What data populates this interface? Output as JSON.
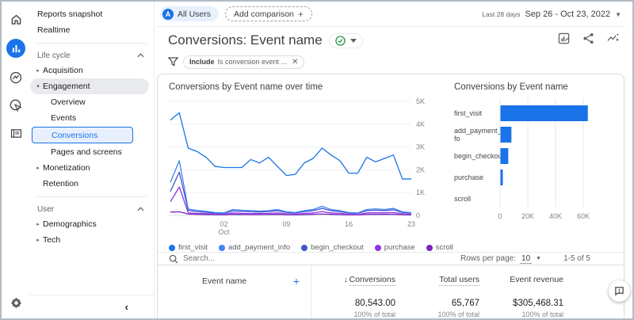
{
  "theme": {
    "accent": "#1a73e8",
    "selected_bg": "#e8f0fe",
    "bar_color": "#1a73e8"
  },
  "rail": {
    "items": [
      "home",
      "reports",
      "explore",
      "advertising",
      "configure"
    ],
    "selected": "reports"
  },
  "sidebar": {
    "primary": [
      {
        "label": "Reports snapshot"
      },
      {
        "label": "Realtime"
      }
    ],
    "sections": [
      {
        "title": "Life cycle",
        "items": [
          {
            "label": "Acquisition"
          },
          {
            "label": "Engagement",
            "expanded": true,
            "children": [
              {
                "label": "Overview"
              },
              {
                "label": "Events"
              },
              {
                "label": "Conversions",
                "selected": true
              },
              {
                "label": "Pages and screens"
              }
            ]
          },
          {
            "label": "Monetization"
          },
          {
            "label": "Retention"
          }
        ]
      },
      {
        "title": "User",
        "items": [
          {
            "label": "Demographics"
          },
          {
            "label": "Tech"
          }
        ]
      }
    ]
  },
  "topbar": {
    "segment_badge": "A",
    "segment_label": "All Users",
    "add_comparison_label": "Add comparison",
    "add_comparison_plus": "+",
    "date_preset": "Last 28 days",
    "date_range": "Sep 26 - Oct 23, 2022"
  },
  "header": {
    "title": "Conversions: Event name"
  },
  "filter": {
    "keyword": "Include",
    "condition": "Is conversion event ...",
    "close": "✕"
  },
  "chart_data": [
    {
      "type": "line",
      "title": "Conversions by Event name over time",
      "ylim": [
        0,
        5000
      ],
      "y_ticks": [
        "0",
        "1K",
        "2K",
        "3K",
        "4K",
        "5K"
      ],
      "x_ticks": [
        {
          "index": 6,
          "label": "02",
          "sub": "Oct"
        },
        {
          "index": 13,
          "label": "09"
        },
        {
          "index": 20,
          "label": "16"
        },
        {
          "index": 27,
          "label": "23"
        }
      ],
      "x_range_days": 28,
      "grid": true,
      "legend_position": "bottom",
      "series": [
        {
          "name": "first_visit",
          "color": "#1a73e8",
          "values": [
            4180,
            4500,
            2950,
            2800,
            2550,
            2150,
            2100,
            2100,
            2100,
            2450,
            2300,
            2550,
            2150,
            1750,
            1800,
            2300,
            2500,
            2950,
            2650,
            2400,
            1850,
            1850,
            2550,
            2350,
            2500,
            2650,
            1600,
            1600
          ]
        },
        {
          "name": "add_payment_info",
          "color": "#4285f4",
          "values": [
            1450,
            2400,
            280,
            220,
            180,
            130,
            110,
            260,
            230,
            210,
            190,
            210,
            260,
            160,
            130,
            210,
            260,
            400,
            260,
            210,
            130,
            110,
            260,
            290,
            260,
            310,
            160,
            120
          ]
        },
        {
          "name": "begin_checkout",
          "color": "#4553c8",
          "values": [
            1050,
            1900,
            220,
            170,
            140,
            100,
            90,
            200,
            180,
            160,
            150,
            170,
            210,
            130,
            100,
            170,
            210,
            310,
            210,
            170,
            100,
            90,
            210,
            230,
            210,
            250,
            130,
            100
          ]
        },
        {
          "name": "purchase",
          "color": "#9334e6",
          "values": [
            600,
            1250,
            110,
            90,
            80,
            60,
            50,
            110,
            90,
            80,
            80,
            90,
            110,
            70,
            50,
            90,
            110,
            170,
            110,
            90,
            50,
            40,
            110,
            120,
            110,
            130,
            70,
            50
          ]
        },
        {
          "name": "scroll",
          "color": "#7627bb",
          "values": [
            150,
            160,
            60,
            50,
            40,
            35,
            30,
            50,
            45,
            40,
            40,
            45,
            50,
            35,
            30,
            40,
            50,
            60,
            50,
            40,
            30,
            25,
            50,
            50,
            50,
            55,
            35,
            25
          ]
        }
      ]
    },
    {
      "type": "bar",
      "title": "Conversions by Event name",
      "orientation": "horizontal",
      "xlim": [
        0,
        65000
      ],
      "x_tick_labels": [
        "0",
        "20K",
        "40K",
        "60K"
      ],
      "x_tick_values": [
        0,
        20000,
        40000,
        60000
      ],
      "bar_color": "#1a73e8",
      "categories": [
        {
          "lines": [
            "first_visit"
          ],
          "value": 63000
        },
        {
          "lines": [
            "add_payment_in",
            "fo"
          ],
          "value": 7900
        },
        {
          "lines": [
            "begin_checkout"
          ],
          "value": 5600
        },
        {
          "lines": [
            "purchase"
          ],
          "value": 1700
        },
        {
          "lines": [
            "scroll"
          ],
          "value": 250
        }
      ]
    }
  ],
  "table": {
    "search_placeholder": "Search...",
    "rows_per_page_label": "Rows per page:",
    "rows_per_page_value": "10",
    "pagination": "1-5 of 5",
    "dimension_column": "Event name",
    "add_column": "+",
    "sort_arrow": "↓",
    "metric_columns": [
      {
        "label": "Conversions",
        "total": "80,543.00",
        "pct": "100% of total"
      },
      {
        "label": "Total users",
        "total": "65,767",
        "pct": "100% of total"
      },
      {
        "label": "Event revenue",
        "total": "$305,468.31",
        "pct": "100% of total"
      }
    ]
  }
}
